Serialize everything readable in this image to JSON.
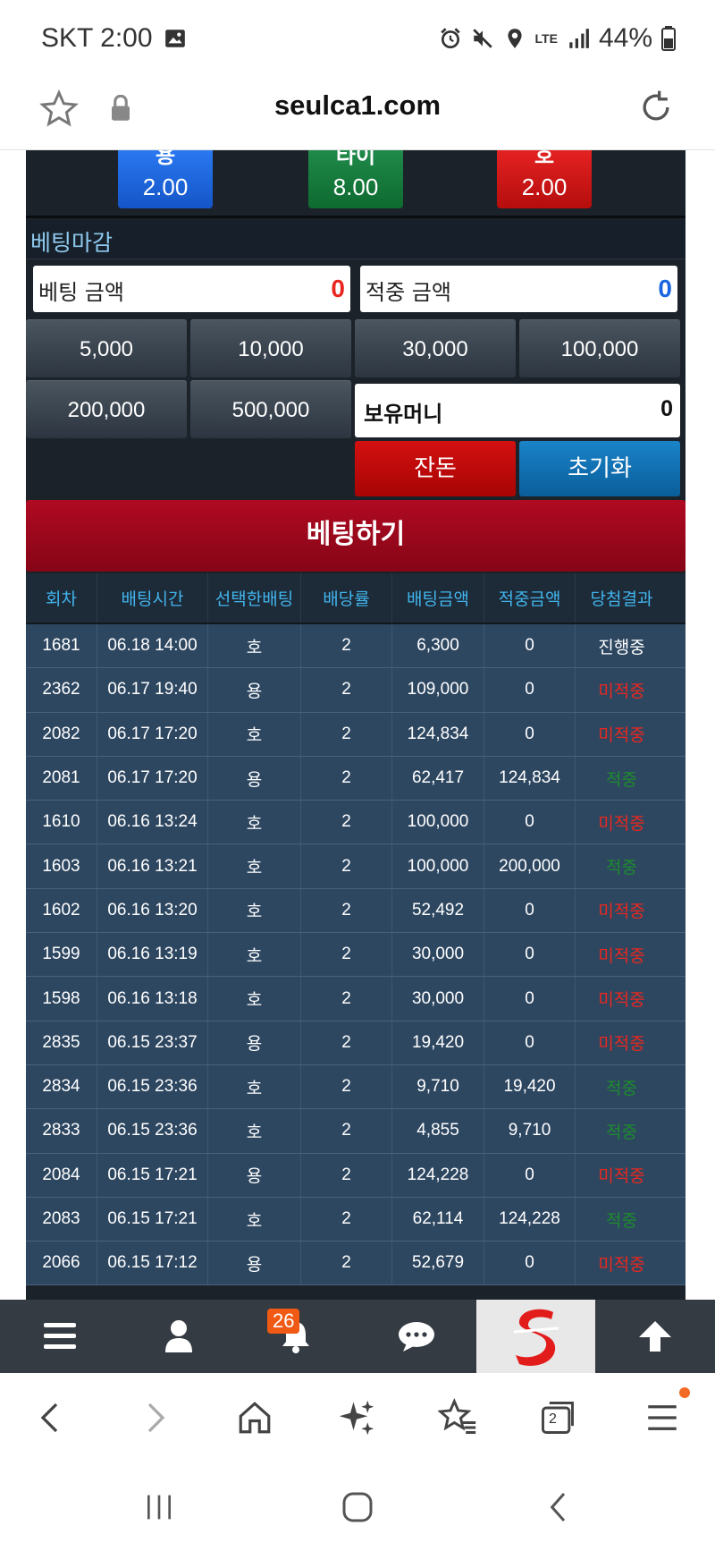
{
  "status_bar": {
    "carrier_time": "SKT 2:00",
    "network": "LTE",
    "battery": "44%"
  },
  "address_bar": {
    "url": "seulca1.com"
  },
  "odds": [
    {
      "name": "용",
      "value": "2.00",
      "color": "#1a66e0"
    },
    {
      "name": "타이",
      "value": "8.00",
      "color": "#167a3c"
    },
    {
      "name": "호",
      "value": "2.00",
      "color": "#d01818"
    }
  ],
  "betting": {
    "closed_label": "베팅마감",
    "bet_amount_label": "베팅 금액",
    "bet_amount_value": "0",
    "win_amount_label": "적중 금액",
    "win_amount_value": "0",
    "chips": [
      "5,000",
      "10,000",
      "30,000",
      "100,000",
      "200,000",
      "500,000"
    ],
    "balance_label": "보유머니",
    "balance_value": "0",
    "cancel_label": "잔돈",
    "reset_label": "초기화",
    "submit_label": "베팅하기"
  },
  "history": {
    "columns": [
      "회차",
      "배팅시간",
      "선택한배팅",
      "배당률",
      "배팅금액",
      "적중금액",
      "당첨결과"
    ],
    "rows": [
      {
        "round": "1681",
        "time": "06.18 14:00",
        "pick": "호",
        "odds": "2",
        "bet": "6,300",
        "win": "0",
        "result": "진행중",
        "status": "pending"
      },
      {
        "round": "2362",
        "time": "06.17 19:40",
        "pick": "용",
        "odds": "2",
        "bet": "109,000",
        "win": "0",
        "result": "미적중",
        "status": "lose"
      },
      {
        "round": "2082",
        "time": "06.17 17:20",
        "pick": "호",
        "odds": "2",
        "bet": "124,834",
        "win": "0",
        "result": "미적중",
        "status": "lose"
      },
      {
        "round": "2081",
        "time": "06.17 17:20",
        "pick": "용",
        "odds": "2",
        "bet": "62,417",
        "win": "124,834",
        "result": "적중",
        "status": "win"
      },
      {
        "round": "1610",
        "time": "06.16 13:24",
        "pick": "호",
        "odds": "2",
        "bet": "100,000",
        "win": "0",
        "result": "미적중",
        "status": "lose"
      },
      {
        "round": "1603",
        "time": "06.16 13:21",
        "pick": "호",
        "odds": "2",
        "bet": "100,000",
        "win": "200,000",
        "result": "적중",
        "status": "win"
      },
      {
        "round": "1602",
        "time": "06.16 13:20",
        "pick": "호",
        "odds": "2",
        "bet": "52,492",
        "win": "0",
        "result": "미적중",
        "status": "lose"
      },
      {
        "round": "1599",
        "time": "06.16 13:19",
        "pick": "호",
        "odds": "2",
        "bet": "30,000",
        "win": "0",
        "result": "미적중",
        "status": "lose"
      },
      {
        "round": "1598",
        "time": "06.16 13:18",
        "pick": "호",
        "odds": "2",
        "bet": "30,000",
        "win": "0",
        "result": "미적중",
        "status": "lose"
      },
      {
        "round": "2835",
        "time": "06.15 23:37",
        "pick": "용",
        "odds": "2",
        "bet": "19,420",
        "win": "0",
        "result": "미적중",
        "status": "lose"
      },
      {
        "round": "2834",
        "time": "06.15 23:36",
        "pick": "호",
        "odds": "2",
        "bet": "9,710",
        "win": "19,420",
        "result": "적중",
        "status": "win"
      },
      {
        "round": "2833",
        "time": "06.15 23:36",
        "pick": "호",
        "odds": "2",
        "bet": "4,855",
        "win": "9,710",
        "result": "적중",
        "status": "win"
      },
      {
        "round": "2084",
        "time": "06.15 17:21",
        "pick": "용",
        "odds": "2",
        "bet": "124,228",
        "win": "0",
        "result": "미적중",
        "status": "lose"
      },
      {
        "round": "2083",
        "time": "06.15 17:21",
        "pick": "호",
        "odds": "2",
        "bet": "62,114",
        "win": "124,228",
        "result": "적중",
        "status": "win"
      },
      {
        "round": "2066",
        "time": "06.15 17:12",
        "pick": "용",
        "odds": "2",
        "bet": "52,679",
        "win": "0",
        "result": "미적중",
        "status": "lose"
      }
    ]
  },
  "status_colors": {
    "pending": "#ffffff",
    "lose": "#e8281e",
    "win": "#1c8c2c"
  },
  "site_nav": {
    "notification_count": "26",
    "items": [
      "menu-icon",
      "user-icon",
      "bell-icon",
      "chat-icon",
      "site-logo",
      "arrow-up-icon"
    ]
  },
  "browser_toolbar": {
    "tab_count": "2",
    "items": [
      "back-icon",
      "forward-icon",
      "home-icon",
      "sparkle-icon",
      "bookmarks-icon",
      "tabs-icon",
      "menu-icon"
    ]
  }
}
